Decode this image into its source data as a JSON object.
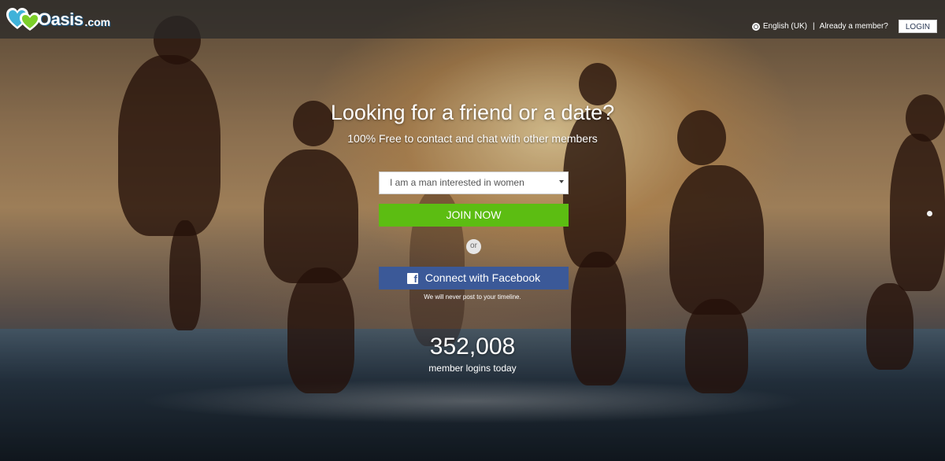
{
  "header": {
    "logo_text": "Oasis",
    "logo_tld": ".com",
    "language_label": "English (UK)",
    "separator": "|",
    "already_member": "Already a member?",
    "login_label": "LOGIN"
  },
  "main": {
    "title": "Looking for a friend or a date?",
    "subtitle": "100% Free to contact and chat with other members",
    "select_value": "I am a man interested in women",
    "join_label": "JOIN NOW",
    "or_label": "or",
    "facebook_label": "Connect with Facebook",
    "facebook_icon_glyph": "f",
    "facebook_note": "We will never post to your timeline.",
    "logins_count": "352,008",
    "logins_label": "member logins today"
  },
  "colors": {
    "join_green": "#5cbd12",
    "facebook_blue": "#3b5998",
    "logo_blue": "#1a5a8a",
    "logo_teal": "#3fb2d9"
  },
  "icons": {
    "logo": "hearts-logo-icon",
    "language": "globe-icon",
    "facebook": "facebook-icon",
    "select": "caret-down-icon"
  }
}
